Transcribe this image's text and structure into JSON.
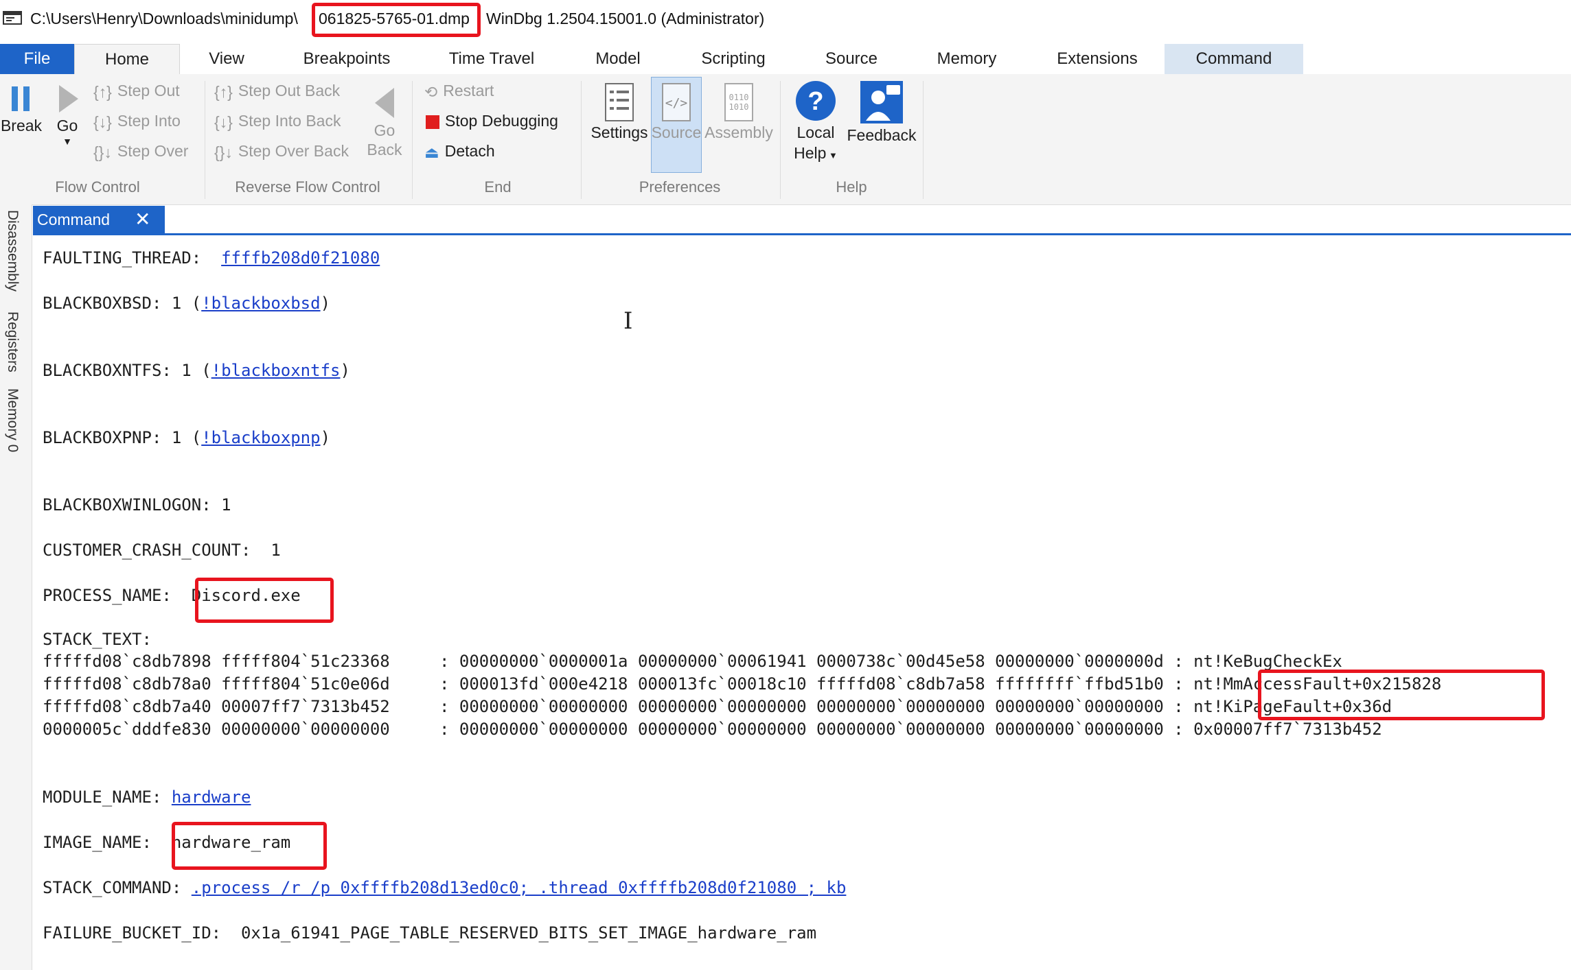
{
  "titlebar": {
    "path": "C:\\Users\\Henry\\Downloads\\minidump\\",
    "file": "061825-5765-01.dmp",
    "app": "WinDbg 1.2504.15001.0 (Administrator)"
  },
  "tabs": [
    "File",
    "Home",
    "View",
    "Breakpoints",
    "Time Travel",
    "Model",
    "Scripting",
    "Source",
    "Memory",
    "Extensions",
    "Command"
  ],
  "ribbon": {
    "flow": {
      "break": "Break",
      "go": "Go",
      "step_out": "Step Out",
      "step_into": "Step Into",
      "step_over": "Step Over",
      "group": "Flow Control"
    },
    "reverse": {
      "step_out_back": "Step Out Back",
      "step_into_back": "Step Into Back",
      "step_over_back": "Step Over Back",
      "go_back_1": "Go",
      "go_back_2": "Back",
      "group": "Reverse Flow Control"
    },
    "end": {
      "restart": "Restart",
      "stop": "Stop Debugging",
      "detach": "Detach",
      "group": "End"
    },
    "prefs": {
      "settings": "Settings",
      "source": "Source",
      "assembly": "Assembly",
      "group": "Preferences"
    },
    "help": {
      "local_help_1": "Local",
      "local_help_2": "Help",
      "feedback": "Feedback",
      "group": "Help"
    }
  },
  "side_tabs": [
    "Disassembly",
    "Registers",
    "Memory 0"
  ],
  "command_tab": {
    "title": "Command",
    "close": "✕"
  },
  "output": {
    "faulting_thread_label": "FAULTING_THREAD:  ",
    "faulting_thread_value": "ffffb208d0f21080",
    "bbsd_label": "BLACKBOXBSD: 1 (",
    "bbsd_link": "!blackboxbsd",
    "bbntfs_label": "BLACKBOXNTFS: 1 (",
    "bbntfs_link": "!blackboxntfs",
    "bbpnp_label": "BLACKBOXPNP: 1 (",
    "bbpnp_link": "!blackboxpnp",
    "close_paren": ")",
    "bbwinlogon": "BLACKBOXWINLOGON: 1",
    "crash_count": "CUSTOMER_CRASH_COUNT:  1",
    "process_label": "PROCESS_NAME:  ",
    "process_value": "Discord.exe",
    "stack_text_label": "STACK_TEXT:",
    "stack_rows": [
      {
        "left": "fffffd08`c8db7898 fffff804`51c23368     : 00000000`0000001a 00000000`00061941 0000738c`00d45e58 00000000`0000000d : ",
        "sym": "nt!KeBugCheckEx"
      },
      {
        "left": "fffffd08`c8db78a0 fffff804`51c0e06d     : 000013fd`000e4218 000013fc`00018c10 fffffd08`c8db7a58 ffffffff`ffbd51b0 : ",
        "sym": "nt!MmAccessFault+0x215828"
      },
      {
        "left": "fffffd08`c8db7a40 00007ff7`7313b452     : 00000000`00000000 00000000`00000000 00000000`00000000 00000000`00000000 : ",
        "sym": "nt!KiPageFault+0x36d"
      },
      {
        "left": "0000005c`dddfe830 00000000`00000000     : 00000000`00000000 00000000`00000000 00000000`00000000 00000000`00000000 : ",
        "sym": "0x00007ff7`7313b452"
      }
    ],
    "module_label": "MODULE_NAME: ",
    "module_value": "hardware",
    "image_label": "IMAGE_NAME:  ",
    "image_value": "hardware_ram",
    "stack_cmd_label": "STACK_COMMAND: ",
    "stack_cmd_value": ".process /r /p 0xffffb208d13ed0c0; .thread 0xffffb208d0f21080 ; kb",
    "bucket": "FAILURE_BUCKET_ID:  0x1a_61941_PAGE_TABLE_RESERVED_BITS_SET_IMAGE_hardware_ram"
  },
  "colors": {
    "accent": "#1e64c8",
    "link": "#1a3ec9",
    "highlight": "#e8141e"
  }
}
